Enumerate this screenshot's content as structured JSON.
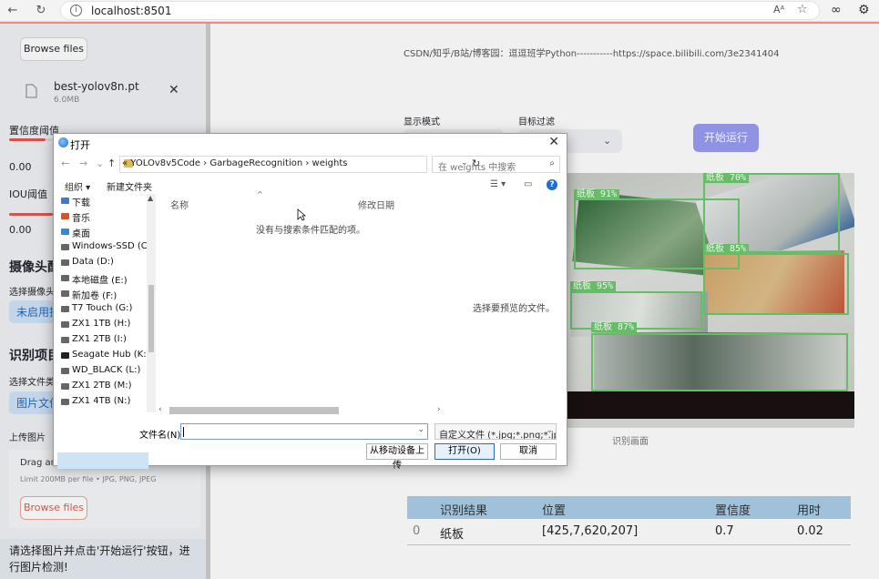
{
  "browser": {
    "url": "localhost:8501"
  },
  "sidebar": {
    "browse_button": "Browse files",
    "file_name": "best-yolov8n.pt",
    "file_size": "6.0MB",
    "conf_label": "置信度阈值",
    "conf_value": "0.00",
    "iou_label": "IOU阈值",
    "iou_value": "0.00",
    "camera_header": "摄像头配",
    "camera_select_label": "选择摄像头",
    "camera_pill": "未启用摄",
    "detect_header": "识别项目",
    "file_type_label": "选择文件类",
    "file_type_pill": "图片文件",
    "upload_label": "上传图片",
    "drag_text": "Drag and drop file here",
    "limit_text": "Limit 200MB per file • JPG, PNG, JPEG",
    "browse_button_2": "Browse files",
    "status_text": "请选择图片并点击'开始运行'按钮，进行图片检测!"
  },
  "main": {
    "top_text": "CSDN/知乎/B站/博客园：逗逗班学Python-----------https://space.bilibili.com/3e2341404",
    "display_mode_label": "显示模式",
    "target_filter_label": "目标过滤",
    "run_button": "开始运行",
    "image_caption": "识别画面",
    "detections": [
      {
        "label": "纸板 91%"
      },
      {
        "label": "纸板 70%"
      },
      {
        "label": "纸板 85%"
      },
      {
        "label": "纸板 95%"
      },
      {
        "label": "纸板 87%"
      }
    ],
    "table": {
      "headers": [
        "识别结果",
        "位置",
        "置信度",
        "用时"
      ],
      "rows": [
        {
          "index": "0",
          "result": "纸板",
          "position": "[425,7,620,207]",
          "confidence": "0.7",
          "time": "0.02"
        }
      ]
    }
  },
  "dialog": {
    "title": "打开",
    "breadcrumbs": "«  YOLOv8v5Code  ›  GarbageRecognition  ›  weights",
    "search_placeholder": "在 weights 中搜索",
    "organize": "组织 ▾",
    "new_folder": "新建文件夹",
    "nav_items": [
      "下载",
      "音乐",
      "桌面",
      "Windows-SSD (C",
      "Data (D:)",
      "本地磁盘 (E:)",
      "新加卷 (F:)",
      "T7 Touch (G:)",
      "ZX1 1TB (H:)",
      "ZX1 2TB (I:)",
      "Seagate Hub (K:",
      "WD_BLACK (L:)",
      "ZX1 2TB (M:)",
      "ZX1 4TB (N:)"
    ],
    "col_name": "名称",
    "col_date": "修改日期",
    "empty_message": "没有与搜索条件匹配的项。",
    "preview_message": "选择要预览的文件。",
    "filename_label": "文件名(N):",
    "filename_value": "",
    "file_type": "自定义文件 (*.jpg;*.png;*.jpeg",
    "mobile_upload": "从移动设备上传",
    "open_button": "打开(O)",
    "cancel_button": "取消"
  }
}
